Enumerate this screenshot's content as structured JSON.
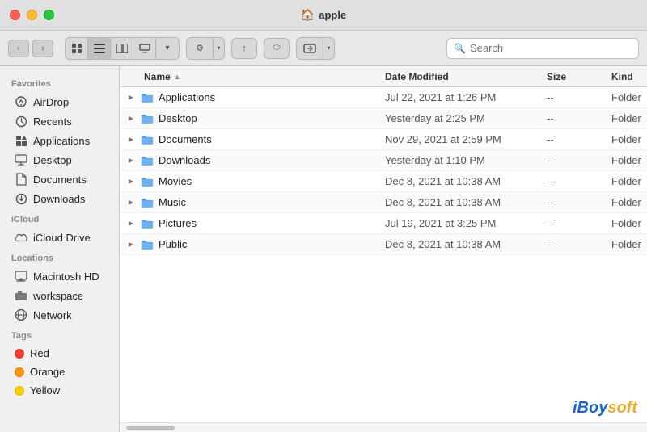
{
  "window": {
    "title": "apple",
    "title_icon": "🏠"
  },
  "toolbar": {
    "back_label": "‹",
    "forward_label": "›",
    "view_icon_label": "⊞",
    "view_list_label": "☰",
    "view_column_label": "⊟",
    "view_gallery_label": "⊡",
    "view_dropdown_arrow": "▾",
    "action_gear_label": "⚙",
    "action_share_label": "↑",
    "action_tag_label": "⬭",
    "action_more_label": "▾",
    "search_placeholder": "Search",
    "search_icon": "🔍"
  },
  "sidebar": {
    "favorites_header": "Favorites",
    "icloud_header": "iCloud",
    "locations_header": "Locations",
    "tags_header": "Tags",
    "items": {
      "favorites": [
        {
          "id": "airdrop",
          "label": "AirDrop",
          "icon": "📡"
        },
        {
          "id": "recents",
          "label": "Recents",
          "icon": "🕐"
        },
        {
          "id": "applications",
          "label": "Applications",
          "icon": "📱"
        },
        {
          "id": "desktop",
          "label": "Desktop",
          "icon": "🖥"
        },
        {
          "id": "documents",
          "label": "Documents",
          "icon": "📄"
        },
        {
          "id": "downloads",
          "label": "Downloads",
          "icon": "⬇"
        }
      ],
      "icloud": [
        {
          "id": "icloud-drive",
          "label": "iCloud Drive",
          "icon": "☁"
        }
      ],
      "locations": [
        {
          "id": "macintosh-hd",
          "label": "Macintosh HD",
          "icon": "💾"
        },
        {
          "id": "workspace",
          "label": "workspace",
          "icon": "🗂"
        },
        {
          "id": "network",
          "label": "Network",
          "icon": "🌐"
        }
      ],
      "tags": [
        {
          "id": "red",
          "label": "Red",
          "color": "#ff3b30"
        },
        {
          "id": "orange",
          "label": "Orange",
          "color": "#ff9500"
        },
        {
          "id": "yellow",
          "label": "Yellow",
          "color": "#ffcc00"
        }
      ]
    }
  },
  "file_list": {
    "columns": {
      "name": "Name",
      "date_modified": "Date Modified",
      "size": "Size",
      "kind": "Kind"
    },
    "rows": [
      {
        "id": "applications",
        "name": "Applications",
        "date": "Jul 22, 2021 at 1:26 PM",
        "size": "--",
        "kind": "Folder"
      },
      {
        "id": "desktop",
        "name": "Desktop",
        "date": "Yesterday at 2:25 PM",
        "size": "--",
        "kind": "Folder"
      },
      {
        "id": "documents",
        "name": "Documents",
        "date": "Nov 29, 2021 at 2:59 PM",
        "size": "--",
        "kind": "Folder"
      },
      {
        "id": "downloads",
        "name": "Downloads",
        "date": "Yesterday at 1:10 PM",
        "size": "--",
        "kind": "Folder"
      },
      {
        "id": "movies",
        "name": "Movies",
        "date": "Dec 8, 2021 at 10:38 AM",
        "size": "--",
        "kind": "Folder"
      },
      {
        "id": "music",
        "name": "Music",
        "date": "Dec 8, 2021 at 10:38 AM",
        "size": "--",
        "kind": "Folder"
      },
      {
        "id": "pictures",
        "name": "Pictures",
        "date": "Jul 19, 2021 at 3:25 PM",
        "size": "--",
        "kind": "Folder"
      },
      {
        "id": "public",
        "name": "Public",
        "date": "Dec 8, 2021 at 10:38 AM",
        "size": "--",
        "kind": "Folder"
      }
    ]
  },
  "watermark": {
    "brand": "iBoysoft",
    "suffix": ""
  }
}
